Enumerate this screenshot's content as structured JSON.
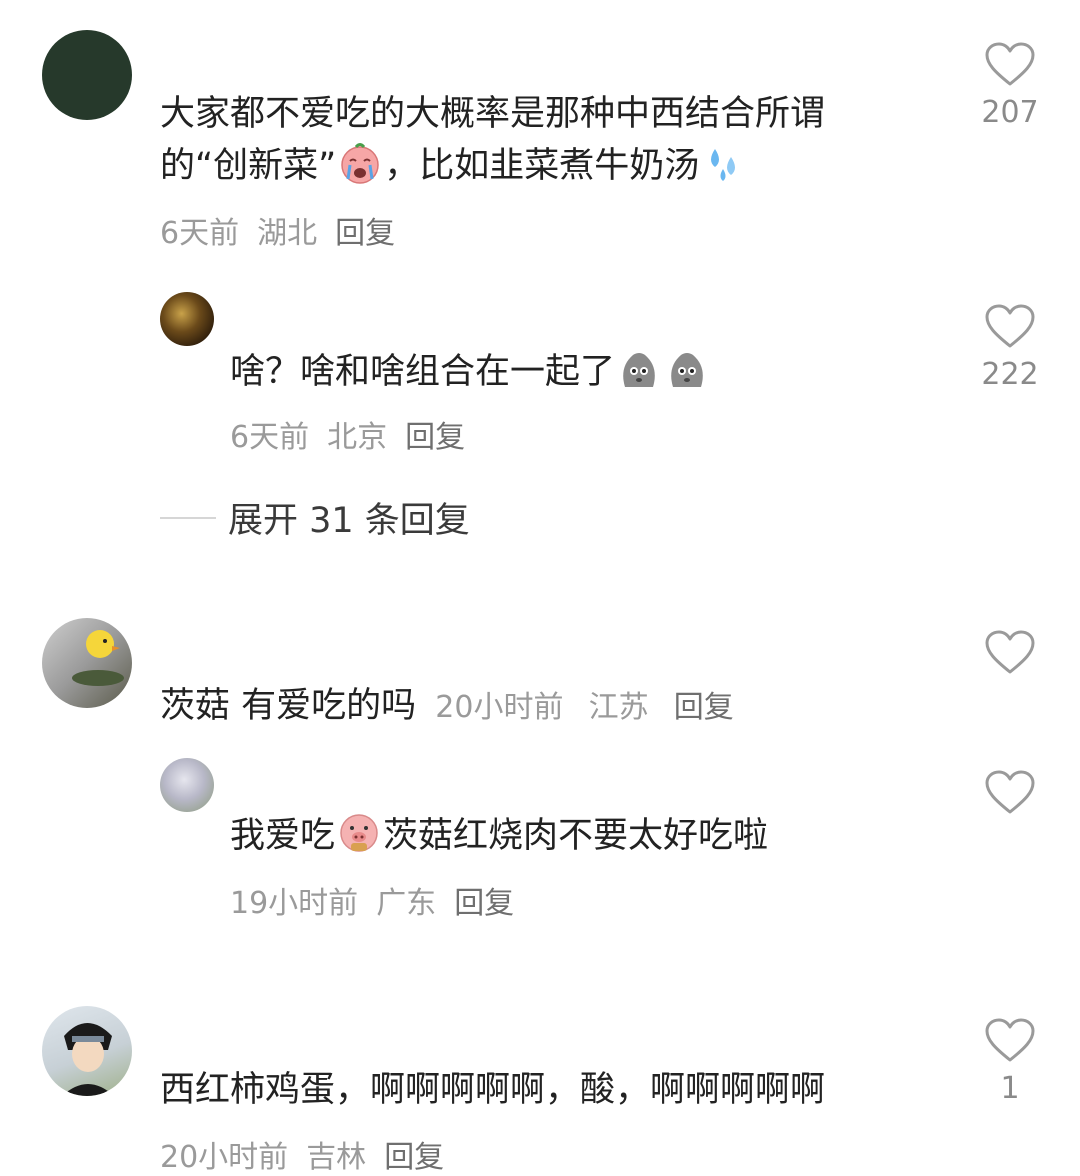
{
  "comments": [
    {
      "text_before": "大家都不爱吃的大概率是那种中西结合所谓",
      "text_line2_before": "的“创新菜”",
      "emoji1": "crying-face-emoji",
      "text_line2_after": "，比如韭菜煮牛奶汤",
      "emoji2": "sweat-drops-emoji",
      "time": "6天前",
      "location": "湖北",
      "reply_label": "回复",
      "likes": "207"
    },
    {
      "text": "啥？啥和啥组合在一起了",
      "emoji": "potato-face-emoji",
      "time": "6天前",
      "location": "北京",
      "reply_label": "回复",
      "likes": "222"
    },
    {
      "text": "茨菇 有爱吃的吗",
      "time": "20小时前",
      "location": "江苏",
      "reply_label": "回复",
      "likes": ""
    },
    {
      "text_before": "我爱吃",
      "emoji": "pig-eating-emoji",
      "text_after": "茨菇红烧肉不要太好吃啦",
      "time": "19小时前",
      "location": "广东",
      "reply_label": "回复",
      "likes": ""
    },
    {
      "text": "西红柿鸡蛋，啊啊啊啊啊，酸，啊啊啊啊啊",
      "time": "20小时前",
      "location": "吉林",
      "reply_label": "回复",
      "likes": "1"
    }
  ],
  "expand_replies": "展开 31 条回复",
  "colors": {
    "text": "#222222",
    "meta": "#9a9a9a",
    "heart_outline": "#9a9a9a"
  }
}
